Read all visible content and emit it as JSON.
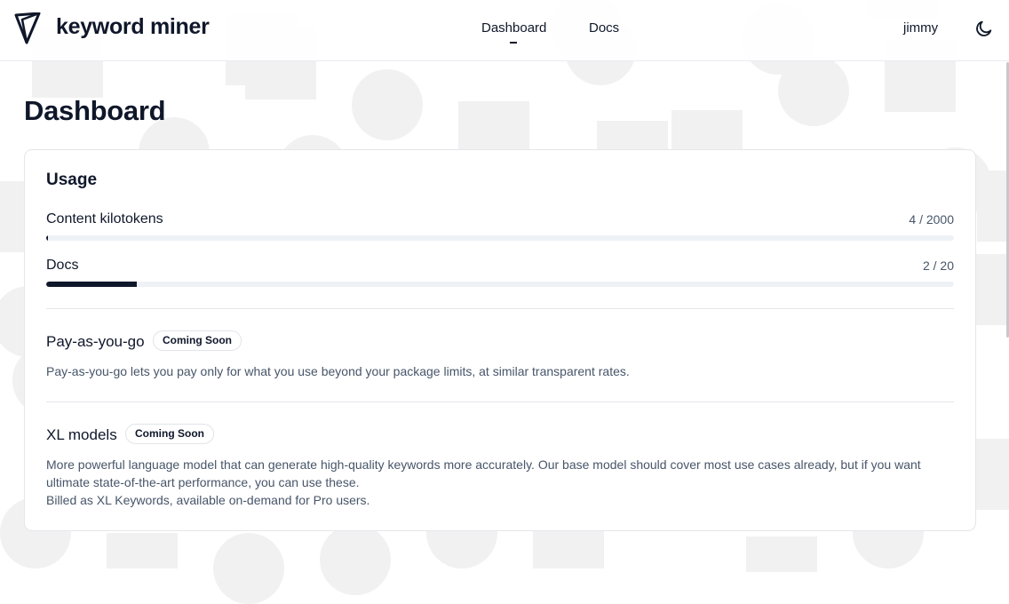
{
  "app": {
    "brand": "keyword miner",
    "logo_icon": "shield-logo-icon"
  },
  "nav": {
    "items": [
      {
        "label": "Dashboard",
        "active": true
      },
      {
        "label": "Docs",
        "active": false
      }
    ]
  },
  "user": {
    "name": "jimmy",
    "theme_icon": "moon-icon"
  },
  "page": {
    "title": "Dashboard"
  },
  "usage": {
    "title": "Usage",
    "items": [
      {
        "label": "Content kilotokens",
        "value": "4 / 2000",
        "used": 4,
        "limit": 2000
      },
      {
        "label": "Docs",
        "value": "2 / 20",
        "used": 2,
        "limit": 20
      }
    ]
  },
  "features": [
    {
      "title": "Pay-as-you-go",
      "badge": "Coming Soon",
      "description": "Pay-as-you-go lets you pay only for what you use beyond your package limits, at similar transparent rates."
    },
    {
      "title": "XL models",
      "badge": "Coming Soon",
      "description_lines": [
        "More powerful language model that can generate high-quality keywords more accurately. Our base model should cover most use cases already, but if you want ultimate state-of-the-art performance, you can use these.",
        "Billed as XL Keywords, available on-demand for Pro users."
      ]
    }
  ],
  "colors": {
    "text_primary": "#0f172a",
    "text_muted": "#475569",
    "bar_track": "#eef2f6",
    "bar_fill": "#0f172a",
    "background_shapes": "#f1f1f2"
  }
}
